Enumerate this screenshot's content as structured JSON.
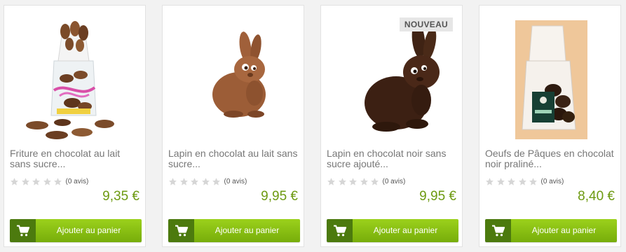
{
  "currency_symbol": "€",
  "colors": {
    "price": "#6d9a11",
    "button": "#84bb0f",
    "button_icon_bg": "#4c7a0e",
    "star_empty": "#d6d6d6"
  },
  "icons": {
    "cart": "shopping-cart-icon",
    "star": "star-icon"
  },
  "products": [
    {
      "name": "Friture en chocolat au lait sans sucre...",
      "rating_stars": 0,
      "reviews": "(0 avis)",
      "price": "9,35 €",
      "badge": "",
      "button_label": "Ajouter au panier"
    },
    {
      "name": "Lapin en chocolat au lait sans sucre...",
      "rating_stars": 0,
      "reviews": "(0 avis)",
      "price": "9,95 €",
      "badge": "",
      "button_label": "Ajouter au panier"
    },
    {
      "name": "Lapin en chocolat noir sans sucre ajouté...",
      "rating_stars": 0,
      "reviews": "(0 avis)",
      "price": "9,95 €",
      "badge": "NOUVEAU",
      "button_label": "Ajouter au panier"
    },
    {
      "name": "Oeufs de Pâques en chocolat noir praliné...",
      "rating_stars": 0,
      "reviews": "(0 avis)",
      "price": "8,40 €",
      "badge": "",
      "button_label": "Ajouter au panier",
      "package_label": "balance"
    }
  ]
}
